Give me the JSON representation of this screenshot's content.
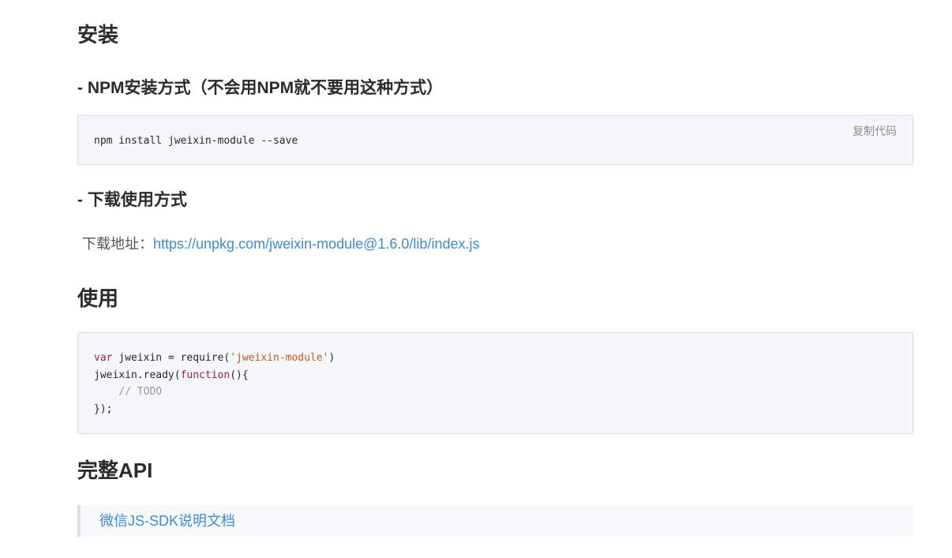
{
  "install": {
    "heading": "安装",
    "npm_heading": "- NPM安装方式（不会用NPM就不要用这种方式）",
    "npm_code": "npm install jweixin-module --save",
    "copy_label": "复制代码",
    "download_heading": "- 下载使用方式",
    "download_label": "下载地址：",
    "download_url": "https://unpkg.com/jweixin-module@1.6.0/lib/index.js"
  },
  "usage": {
    "heading": "使用",
    "code": {
      "line1_kw": "var",
      "line1_mid": " jweixin = require(",
      "line1_str": "'jweixin-module'",
      "line1_end": ")",
      "line2_start": "jweixin.ready(",
      "line2_kw": "function",
      "line2_end": "(){",
      "line3_comment": "    // TODO",
      "line4": "});"
    }
  },
  "api": {
    "heading": "完整API",
    "doc_link": "微信JS-SDK说明文档"
  },
  "colors": {
    "link": "#3f8ccf",
    "keyword": "#a31568",
    "string": "#c7581f",
    "comment": "#999999",
    "code_bg": "#f6f7f9"
  }
}
